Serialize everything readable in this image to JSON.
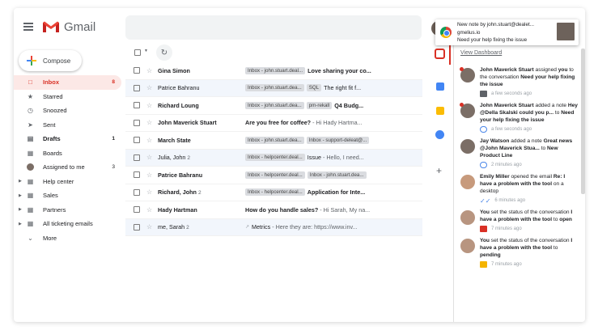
{
  "header": {
    "app_name": "Gmail"
  },
  "compose_label": "Compose",
  "sidebar": {
    "items": [
      {
        "label": "Inbox",
        "count": "8",
        "icon": "inbox-icon"
      },
      {
        "label": "Starred",
        "count": "",
        "icon": "star-icon"
      },
      {
        "label": "Snoozed",
        "count": "",
        "icon": "clock-icon"
      },
      {
        "label": "Sent",
        "count": "",
        "icon": "send-icon"
      },
      {
        "label": "Drafts",
        "count": "1",
        "icon": "draft-icon"
      },
      {
        "label": "Boards",
        "count": "",
        "icon": "boards-icon"
      },
      {
        "label": "Assigned to me",
        "count": "3",
        "icon": "avatar-icon"
      },
      {
        "label": "Help center",
        "count": "",
        "icon": "label-icon"
      },
      {
        "label": "Sales",
        "count": "",
        "icon": "label-icon"
      },
      {
        "label": "Partners",
        "count": "",
        "icon": "label-icon"
      },
      {
        "label": "All ticketing emails",
        "count": "",
        "icon": "label-icon"
      },
      {
        "label": "More",
        "count": "",
        "icon": "chevron-down-icon"
      }
    ]
  },
  "emails": [
    {
      "sender": "Gina Simon",
      "n": "",
      "chips": [
        "Inbox - john.stuart.deal..."
      ],
      "subject": "Love sharing your co...",
      "snippet": ""
    },
    {
      "sender": "Patrice Bahranu",
      "n": "",
      "chips": [
        "Inbox - john.stuart.dea...",
        "SQL"
      ],
      "subject": "The right fit f...",
      "snippet": ""
    },
    {
      "sender": "Richard Loung",
      "n": "",
      "chips": [
        "Inbox - john.stuart.dea...",
        "pm-rekall"
      ],
      "subject": "Q4 Budg...",
      "snippet": ""
    },
    {
      "sender": "John Maverick Stuart",
      "n": "",
      "chips": [],
      "subject": "Are you free for coffee?",
      "snippet": " - Hi Hady Hartma..."
    },
    {
      "sender": "March State",
      "n": "",
      "chips": [
        "Inbox - john.stuart.dea...",
        "Inbox - support-deleat@..."
      ],
      "subject": "",
      "snippet": ""
    },
    {
      "sender": "Julia, John",
      "n": "2",
      "chips": [
        "Inbox - helpcenter.deal..."
      ],
      "subject": "Issue",
      "snippet": " - Hello, I need..."
    },
    {
      "sender": "Patrice Bahranu",
      "n": "",
      "chips": [
        "Inbox - helpcenter.deal...",
        "Inbox - john.stuart.dea..."
      ],
      "subject": "",
      "snippet": ""
    },
    {
      "sender": "Richard, John",
      "n": "2",
      "chips": [
        "Inbox - helpcenter.deal..."
      ],
      "subject": "Application for Inte...",
      "snippet": ""
    },
    {
      "sender": "Hady Hartman",
      "n": "",
      "chips": [],
      "subject": "How do you handle sales?",
      "snippet": " - Hi Sarah, My na..."
    },
    {
      "sender": "me, Sarah",
      "n": "2",
      "chips": [],
      "subject": "Metrics",
      "snippet": " - Here they are: https://www.inv..."
    }
  ],
  "notification": {
    "title": "New note by john.stuart@dealet...",
    "source": "gmelius.io",
    "message": "Need your help fixing the issue"
  },
  "panel": {
    "view_dashboard": "View Dashboard",
    "feed": [
      {
        "actor": "John Maverick Stuart",
        "mid1": " assigned ",
        "bold1": "you",
        "mid2": " to the conversation ",
        "bold2": "Need your help fixing the issue",
        "time": "a few seconds ago",
        "meta_icon": "assign"
      },
      {
        "actor": "John Maverick Stuart",
        "mid1": " added a note ",
        "bold1": "Hey @Della Skalski could you p...",
        "mid2": " to ",
        "bold2": "Need your help fixing the issue",
        "time": "a few seconds ago",
        "meta_icon": "bubble"
      },
      {
        "actor": "Jay Watson",
        "mid1": " added a note ",
        "bold1": "Great news @John Maverick Stua...",
        "mid2": " to ",
        "bold2": "New Product Line",
        "time": "2 minutes ago",
        "meta_icon": "bubble"
      },
      {
        "actor": "Emily Miller",
        "mid1": " opened the email ",
        "bold1": "Re: I have a problem with the tool",
        "mid2": " on a desktop",
        "bold2": "",
        "time": "6 minutes ago",
        "meta_icon": "check"
      },
      {
        "actor": "You",
        "mid1": " set the status of the conversation ",
        "bold1": "I have a problem with the tool",
        "mid2": " to ",
        "bold2": "open",
        "time": "7 minutes ago",
        "meta_icon": "red"
      },
      {
        "actor": "You",
        "mid1": " set the status of the conversation ",
        "bold1": "I have a problem with the tool",
        "mid2": " to ",
        "bold2": "pending",
        "time": "7 minutes ago",
        "meta_icon": "yellow"
      }
    ]
  },
  "colors": {
    "accent_red": "#d93025",
    "active_bg": "#fce8e6",
    "link_blue": "#4a86e8"
  }
}
